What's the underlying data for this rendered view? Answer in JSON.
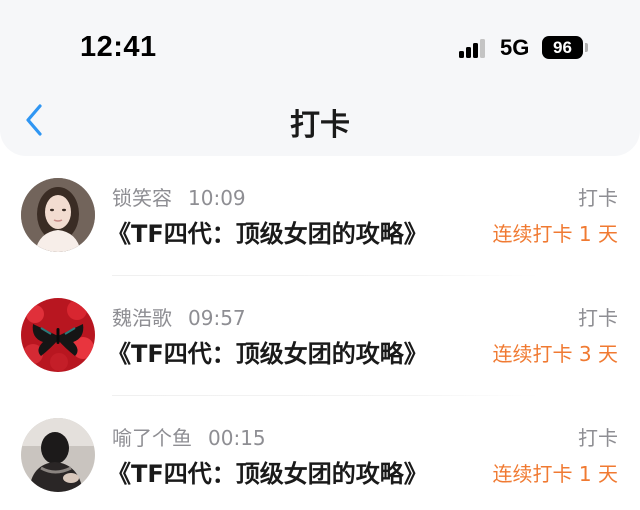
{
  "status_bar": {
    "time": "12:41",
    "network": "5G",
    "battery": "96"
  },
  "nav": {
    "title": "打卡",
    "back_icon": "chevron-left-icon"
  },
  "entries": [
    {
      "username": "锁笑容",
      "time": "10:09",
      "book_title": "《TF四代：顶级女团的攻略》",
      "action": "打卡",
      "streak": "连续打卡 1 天"
    },
    {
      "username": "魏浩歌",
      "time": "09:57",
      "book_title": "《TF四代：顶级女团的攻略》",
      "action": "打卡",
      "streak": "连续打卡 3 天"
    },
    {
      "username": "喻了个鱼",
      "time": "00:15",
      "book_title": "《TF四代：顶级女团的攻略》",
      "action": "打卡",
      "streak": "连续打卡 1 天"
    }
  ],
  "colors": {
    "accent_blue": "#2f96f3",
    "streak_orange": "#f07a32",
    "header_bg": "#f6f7f9"
  }
}
